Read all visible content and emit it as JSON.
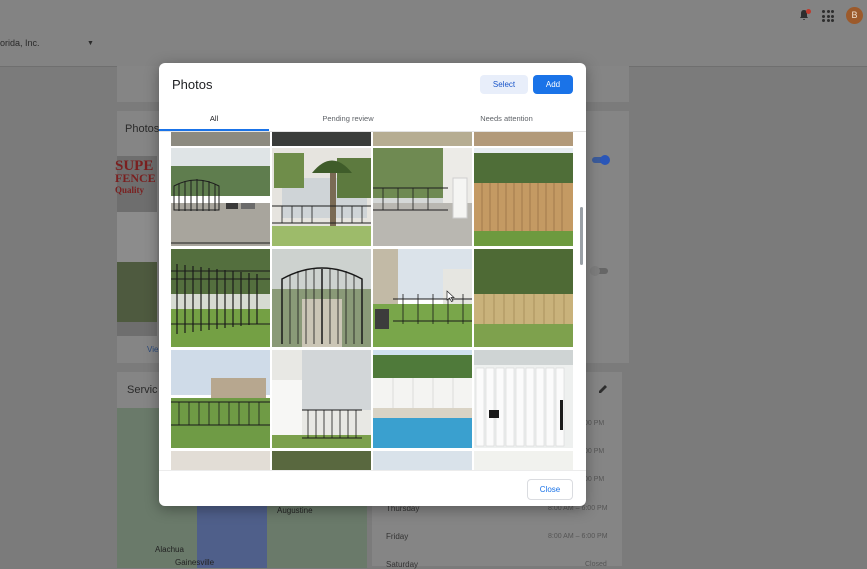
{
  "background": {
    "business_name": "orida, Inc.",
    "photos_heading": "Photos",
    "services_heading": "Servic",
    "view_link": "Vie",
    "logo_text": [
      "SUPE",
      "FENCE",
      "Quality"
    ],
    "hours": [
      {
        "day": "",
        "time": "00 PM"
      },
      {
        "day": "",
        "time": "00 PM"
      },
      {
        "day": "",
        "time": "00 PM"
      },
      {
        "day": "Thursday",
        "time": "8:00 AM – 6:00 PM"
      },
      {
        "day": "Friday",
        "time": "8:00 AM – 6:00 PM"
      },
      {
        "day": "Saturday",
        "time": "Closed"
      }
    ],
    "map_labels": [
      "Alachua",
      "Gainesville",
      "Augustine"
    ],
    "avatar_letter": "B"
  },
  "dialog": {
    "title": "Photos",
    "select_label": "Select",
    "add_label": "Add",
    "tabs": [
      {
        "label": "All",
        "active": true
      },
      {
        "label": "Pending review",
        "active": false
      },
      {
        "label": "Needs attention",
        "active": false
      }
    ],
    "close_label": "Close"
  },
  "photos": [
    {
      "name": "photo-black-rolling-gate-parking"
    },
    {
      "name": "photo-palm-tree-porch-railing"
    },
    {
      "name": "photo-porch-aluminum-railing"
    },
    {
      "name": "photo-wood-privacy-fence"
    },
    {
      "name": "photo-black-fence-lawn"
    },
    {
      "name": "photo-arched-black-gate-path"
    },
    {
      "name": "photo-black-fence-houses"
    },
    {
      "name": "photo-wood-picket-fence-yard"
    },
    {
      "name": "photo-black-fence-pond-house"
    },
    {
      "name": "photo-black-fence-white-house"
    },
    {
      "name": "photo-white-vinyl-fence-pool"
    },
    {
      "name": "photo-white-vinyl-gate"
    }
  ],
  "colors": {
    "accent": "#1a73e8",
    "select_bg": "#e8eefa"
  }
}
